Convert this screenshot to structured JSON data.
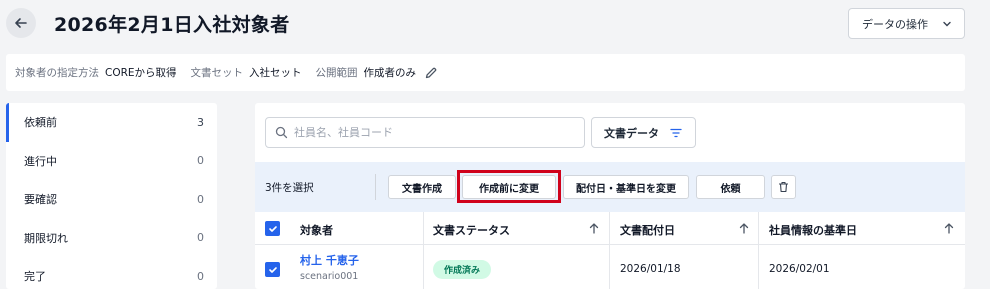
{
  "header": {
    "title": "2026年2月1日入社対象者",
    "data_ops_label": "データの操作"
  },
  "info": {
    "method_label": "対象者の指定方法",
    "method_value": "COREから取得",
    "docset_label": "文書セット",
    "docset_value": "入社セット",
    "scope_label": "公開範囲",
    "scope_value": "作成者のみ"
  },
  "sidebar": {
    "items": [
      {
        "label": "依頼前",
        "count": "3"
      },
      {
        "label": "進行中",
        "count": "0"
      },
      {
        "label": "要確認",
        "count": "0"
      },
      {
        "label": "期限切れ",
        "count": "0"
      },
      {
        "label": "完了",
        "count": "0"
      }
    ]
  },
  "search": {
    "placeholder": "社員名、社員コード"
  },
  "filter": {
    "label": "文書データ"
  },
  "actions": {
    "selected": "3件を選択",
    "create_doc": "文書作成",
    "change_to_pre": "作成前に変更",
    "change_dates": "配付日・基準日を変更",
    "request": "依頼"
  },
  "table": {
    "headers": [
      "対象者",
      "文書ステータス",
      "文書配付日",
      "社員情報の基準日"
    ],
    "rows": [
      {
        "name": "村上 千恵子",
        "sub": "scenario001",
        "status": "作成済み",
        "delivery_date": "2026/01/18",
        "base_date": "2026/02/01"
      }
    ]
  },
  "colors": {
    "accent": "#2563eb",
    "highlight": "#d0021b",
    "status_bg": "#d1fae5",
    "status_fg": "#047857"
  }
}
